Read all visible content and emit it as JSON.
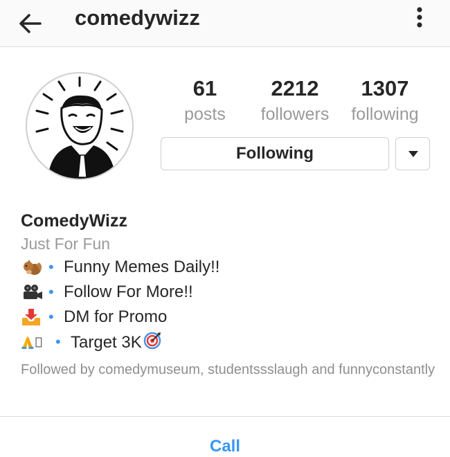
{
  "header": {
    "username": "comedywizz",
    "back_icon": "arrow-left-icon",
    "more_icon": "more-vertical-icon"
  },
  "stats": {
    "posts": {
      "value": "61",
      "label": "posts"
    },
    "followers": {
      "value": "2212",
      "label": "followers"
    },
    "following": {
      "value": "1307",
      "label": "following"
    }
  },
  "actions": {
    "following_label": "Following",
    "dropdown_icon": "caret-down-icon"
  },
  "bio": {
    "name": "ComedyWizz",
    "tagline": "Just For Fun",
    "lines": [
      {
        "icon": "chipmunk-icon",
        "text": "Funny Memes Daily!!"
      },
      {
        "icon": "movie-camera-icon",
        "text": "Follow For More!!"
      },
      {
        "icon": "inbox-tray-icon",
        "text": "DM for Promo"
      },
      {
        "icon": "folded-hands-icon",
        "text": "Target 3K",
        "trailing_icon": "direct-hit-icon"
      }
    ],
    "bullet": "•",
    "followed_by": "Followed by comedymuseum, studentssslaugh and funnyconstantly"
  },
  "footer": {
    "call_label": "Call"
  },
  "colors": {
    "accent": "#3897f0",
    "text": "#262626",
    "muted": "#9a9a9a",
    "border": "#dbdbdb"
  }
}
